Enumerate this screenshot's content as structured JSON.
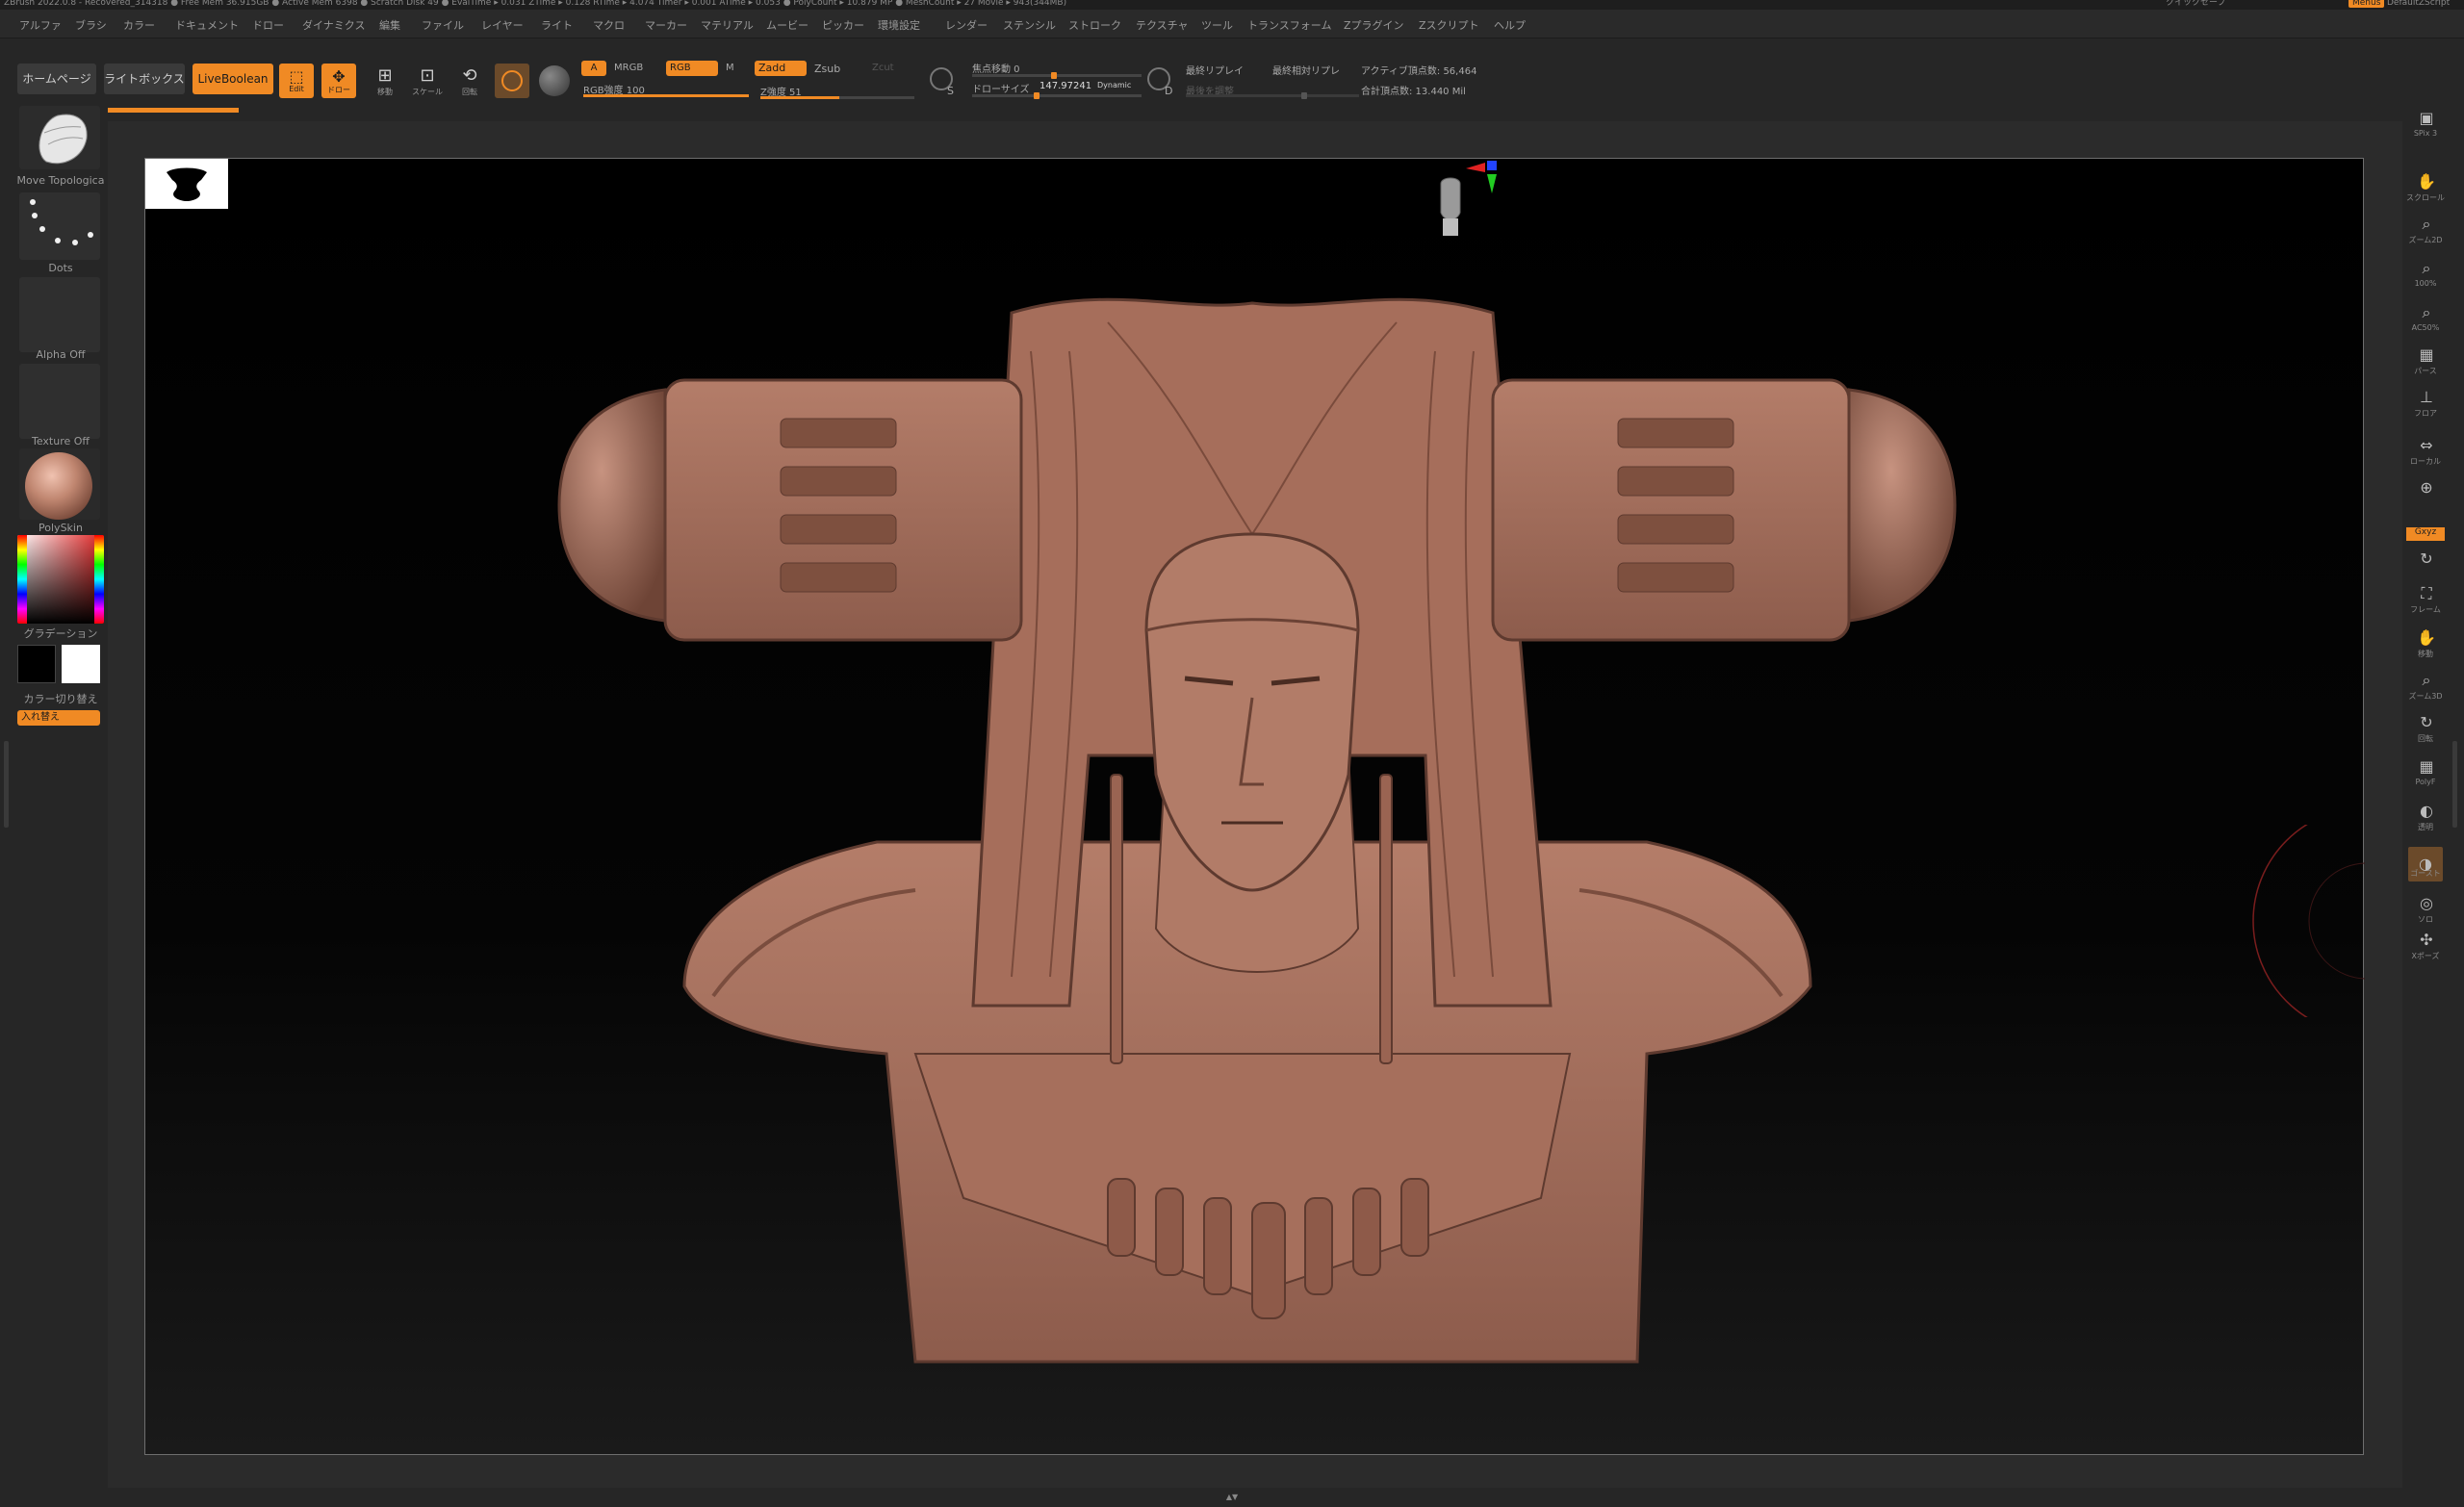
{
  "titlebar": {
    "left": "ZBrush 2022.0.8 - Recovered_314318 ● Free Mem 36.915GB ● Active Mem 6398 ● Scratch Disk 49 ● EvalTime ▸ 0.031 ZTime ▸ 0.128 RTime ▸ 4.074 Timer ▸ 0.001 ATime ▸ 0.053 ● PolyCount ▸ 10.879 MP ● MeshCount ▸ 27 Movie ▸ 943(344MB)",
    "quicksave": "クイックセーブ",
    "menus_badge": "Menus",
    "script": "DefaultZScript"
  },
  "menubar": [
    "アルファ",
    "ブラシ",
    "カラー",
    "ドキュメント",
    "ドロー",
    "ダイナミクス",
    "編集",
    "ファイル",
    "レイヤー",
    "ライト",
    "マクロ",
    "マーカー",
    "マテリアル",
    "ムービー",
    "ピッカー",
    "環境設定",
    "レンダー",
    "ステンシル",
    "ストローク",
    "テクスチャ",
    "ツール",
    "トランスフォーム",
    "Zプラグイン",
    "Zスクリプト",
    "ヘルプ"
  ],
  "toolbar": {
    "home": "ホームページ",
    "lightbox": "ライトボックス",
    "liveboolean": "LiveBoolean",
    "edit": "Edit",
    "draw": "ドロー",
    "move": "移動",
    "scale": "スケール",
    "rotate": "回転",
    "a": "A",
    "mrgb": "MRGB",
    "rgb": "RGB",
    "m": "M",
    "zadd": "Zadd",
    "zsub": "Zsub",
    "zcut": "Zcut",
    "rgb_intensity": "RGB強度 100",
    "z_intensity": "Z強度 51",
    "z_intensity_value": 51,
    "focal_shift": "焦点移動 0",
    "draw_size_label": "ドローサイズ",
    "draw_size": "147.97241",
    "dynamic": "Dynamic",
    "s_key": "S",
    "d_key": "D",
    "last_replay": "最終リプレイ",
    "last_replay_rel": "最終相対リプレ",
    "adjust_last": "最後を調整",
    "active_points": "アクティブ頂点数: 56,464",
    "total_points": "合計頂点数: 13.440 Mil"
  },
  "left": {
    "brush": "Move Topologica",
    "stroke": "Dots",
    "alpha": "Alpha Off",
    "texture": "Texture Off",
    "material": "PolySkin",
    "gradient": "グラデーション",
    "switch_color": "カラー切り替え",
    "swap": "入れ替え"
  },
  "right": [
    {
      "label": "SPix 3",
      "icon": "bpr-icon"
    },
    {
      "label": "スクロール",
      "icon": "scroll-icon"
    },
    {
      "label": "ズーム2D",
      "icon": "zoom2d-icon"
    },
    {
      "label": "100%",
      "icon": "actual-icon"
    },
    {
      "label": "AC50%",
      "icon": "halfsize-icon"
    },
    {
      "label": "パース",
      "icon": "persp-icon"
    },
    {
      "label": "フロア",
      "icon": "floor-icon"
    },
    {
      "label": "ローカル",
      "icon": "local-icon"
    },
    {
      "label": "",
      "icon": "lsym-icon"
    },
    {
      "label": "Gxyz",
      "icon": "xyz-icon"
    },
    {
      "label": "",
      "icon": "rot-icon"
    },
    {
      "label": "フレーム",
      "icon": "frame-icon"
    },
    {
      "label": "移動",
      "icon": "move-icon"
    },
    {
      "label": "ズーム3D",
      "icon": "zoom3d-icon"
    },
    {
      "label": "回転",
      "icon": "rotate-icon"
    },
    {
      "label": "PolyF",
      "icon": "polyf-icon"
    },
    {
      "label": "透明",
      "icon": "transp-icon"
    },
    {
      "label": "ゴースト",
      "icon": "ghost-icon"
    },
    {
      "label": "ソロ",
      "icon": "solo-icon"
    },
    {
      "label": "Xポーズ",
      "icon": "xpose-icon"
    }
  ],
  "colors": {
    "accent": "#f08a24",
    "clay": "#a8715f",
    "clay_dark": "#5e3a2f"
  }
}
